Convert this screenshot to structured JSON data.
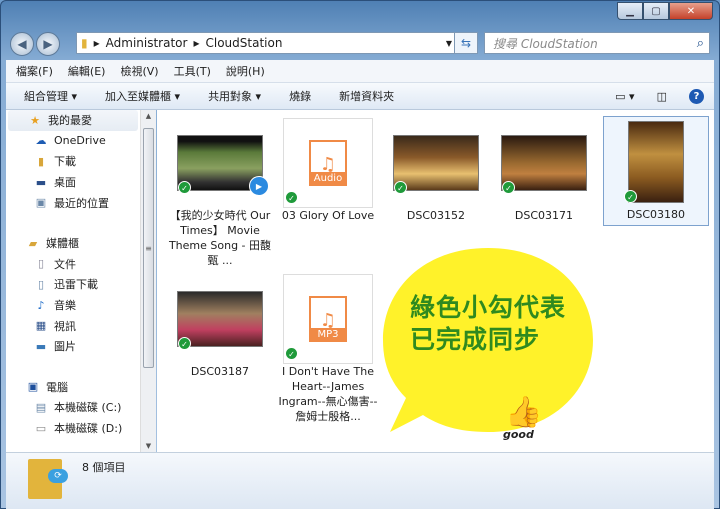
{
  "address": {
    "path": [
      "Administrator",
      "CloudStation"
    ]
  },
  "search": {
    "placeholder": "搜尋 CloudStation"
  },
  "menu": [
    "檔案(F)",
    "編輯(E)",
    "檢視(V)",
    "工具(T)",
    "說明(H)"
  ],
  "toolbar": {
    "organize": "組合管理 ▾",
    "add_library": "加入至媒體櫃 ▾",
    "share": "共用對象 ▾",
    "burn": "燒錄",
    "new_folder": "新增資料夾",
    "help": "?"
  },
  "sidebar": {
    "favorites": "我的最愛",
    "fav_items": [
      "OneDrive",
      "下載",
      "桌面",
      "最近的位置"
    ],
    "libraries": "媒體櫃",
    "lib_items": [
      "文件",
      "迅雷下載",
      "音樂",
      "視訊",
      "圖片"
    ],
    "computer": "電腦",
    "comp_items": [
      "本機磁碟 (C:)",
      "本機磁碟 (D:)"
    ]
  },
  "files": [
    {
      "name": "【我的少女時代 Our Times】 Movie Theme Song - 田馥甄 ...",
      "type": "video"
    },
    {
      "name": "03 Glory Of Love",
      "type": "audio",
      "badge": "Audio"
    },
    {
      "name": "DSC03152",
      "type": "image"
    },
    {
      "name": "DSC03171",
      "type": "image"
    },
    {
      "name": "DSC03180",
      "type": "image"
    },
    {
      "name": "DSC03187",
      "type": "image"
    },
    {
      "name": "I Don't Have The Heart--James Ingram--無心傷害--詹姆士殷格...",
      "type": "audio",
      "badge": "MP3"
    }
  ],
  "status": {
    "count": "8 個項目"
  },
  "callout": {
    "text": "綠色小勾代表已完成同步",
    "sticker": "good"
  },
  "colors": {
    "sync_check": "#1f9a3a",
    "callout_bg": "#fff22a",
    "callout_text": "#2f8a1f"
  }
}
